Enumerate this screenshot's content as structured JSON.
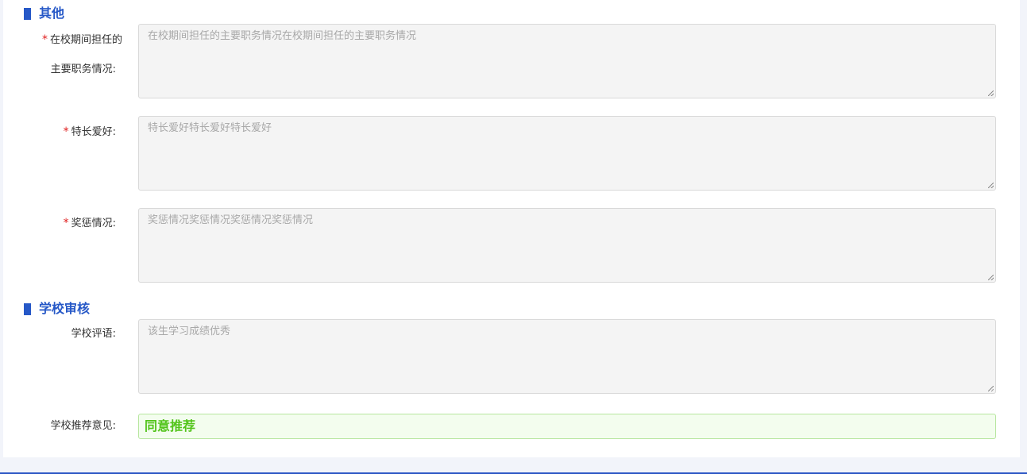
{
  "sections": {
    "other": {
      "title": "其他"
    },
    "school_review": {
      "title": "学校审核"
    }
  },
  "fields": {
    "duties": {
      "label_line1": "在校期间担任的",
      "label_line2": "主要职务情况:",
      "value": "在校期间担任的主要职务情况在校期间担任的主要职务情况",
      "required": true
    },
    "hobbies": {
      "label": "特长爱好:",
      "value": "特长爱好特长爱好特长爱好",
      "required": true
    },
    "awards": {
      "label": "奖惩情况:",
      "value": "奖惩情况奖惩情况奖惩情况奖惩情况",
      "required": true
    },
    "school_comment": {
      "label": "学校评语:",
      "value": "该生学习成绩优秀",
      "required": false
    },
    "school_recommendation": {
      "label": "学校推荐意见:",
      "value": "同意推荐",
      "required": false
    }
  },
  "required_mark": "*",
  "colors": {
    "accent": "#2658c7",
    "required": "#e02020",
    "success": "#52c41a",
    "success_bg": "#f3fdee",
    "disabled_bg": "#f4f4f4"
  }
}
